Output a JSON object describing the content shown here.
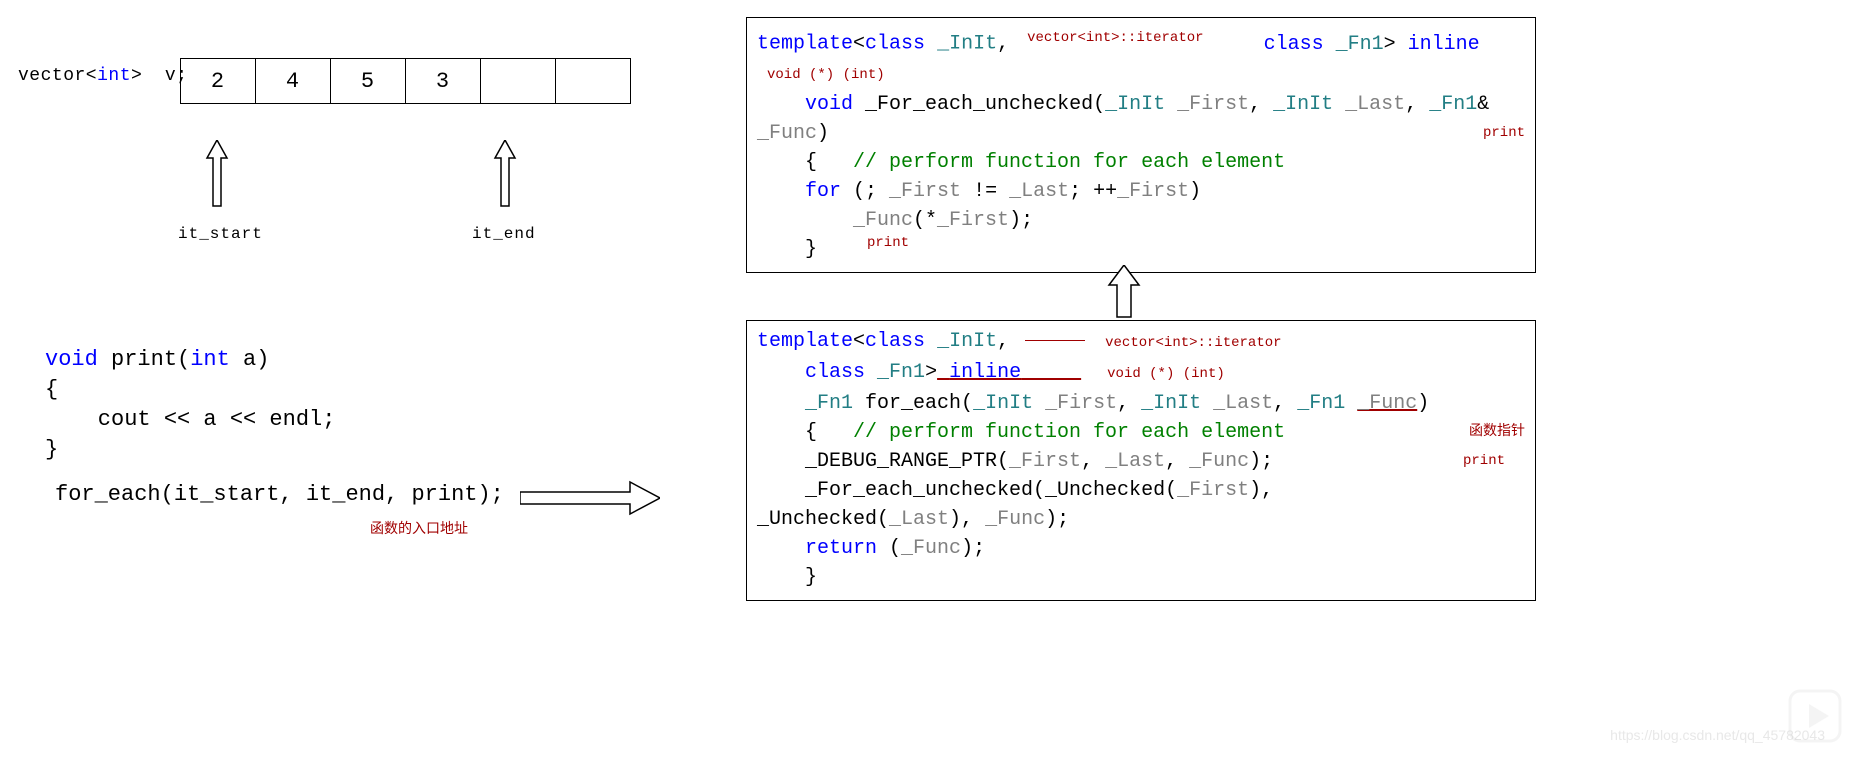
{
  "left": {
    "vector_decl_html": "vector&lt;<span class='kw'>int</span>&gt; &nbsp;v;",
    "cells": [
      "2",
      "4",
      "5",
      "3",
      "",
      ""
    ],
    "it_start": "it_start",
    "it_end": "it_end",
    "print_fn": {
      "l1_html": "<span class='kw'>void</span> print(<span class='kw'>int</span> a)",
      "l2": "{",
      "l3_html": "&nbsp;&nbsp;&nbsp;&nbsp;cout &lt;&lt; a &lt;&lt; endl;",
      "l4": "}"
    },
    "for_each_call": "for_each(it_start, it_end, print);",
    "entry_note": "函数的入口地址"
  },
  "right": {
    "anno_iterator": "vector<int>::iterator",
    "anno_voidfn": "void (*) (int)",
    "anno_print": "print",
    "anno_ptr_cn": "函数指针",
    "top": {
      "l1_html": "<span class='kw'>template</span>&lt;<span class='kw'>class</span> <span class='type'>_InIt</span>,",
      "l2_html": "&nbsp;&nbsp;&nbsp;&nbsp;<span class='kw'>class</span> <span class='type'>_Fn1</span>&gt; <span class='kw'>inline</span>",
      "l3_html": "&nbsp;&nbsp;&nbsp;&nbsp;<span class='kw'>void</span> _For_each_unchecked(<span class='type'>_InIt</span> <span class='gray'>_First</span>, <span class='type'>_InIt</span> <span class='gray'>_Last</span>, <span class='type'>_Fn1</span>&amp;",
      "l3b_html": "<span class='gray'>_Func</span>)",
      "l4_html": "&nbsp;&nbsp;&nbsp;&nbsp;{&nbsp;&nbsp;&nbsp;<span class='cmt'>// perform function for each element</span>",
      "l5_html": "&nbsp;&nbsp;&nbsp;&nbsp;<span class='kw'>for</span> (; <span class='gray'>_First</span> != <span class='gray'>_Last</span>; ++<span class='gray'>_First</span>)",
      "l6_html": "&nbsp;&nbsp;&nbsp;&nbsp;&nbsp;&nbsp;&nbsp;&nbsp;<span class='gray'>_Func</span>(*<span class='gray'>_First</span>);",
      "l7_html": "&nbsp;&nbsp;&nbsp;&nbsp;}"
    },
    "bottom": {
      "l1_html": "<span class='kw'>template</span>&lt;<span class='kw'>class</span> <span class='type'>_InIt</span>, <span class='anno-line'></span>",
      "l2_html": "&nbsp;&nbsp;&nbsp;&nbsp;<span class='kw'>class</span> <span class='type'>_Fn1</span>&gt;<span class='red-underline'>&nbsp;<span class='kw'>inline</span>&nbsp;&nbsp;&nbsp;&nbsp;&nbsp;</span>",
      "l3_html": "&nbsp;&nbsp;&nbsp;&nbsp;<span class='type'>_Fn1</span> for_each(<span class='type'>_InIt</span> <span class='gray'>_First</span>, <span class='type'>_InIt</span> <span class='gray'>_Last</span>, <span class='type'>_Fn1</span> <span class='gray red-underline'>_Func</span>)",
      "l4_html": "&nbsp;&nbsp;&nbsp;&nbsp;{&nbsp;&nbsp;&nbsp;<span class='cmt'>// perform function for each element</span>",
      "l5_html": "&nbsp;&nbsp;&nbsp;&nbsp;_DEBUG_RANGE_PTR(<span class='gray'>_First</span>, <span class='gray'>_Last</span>, <span class='gray'>_Func</span>);",
      "l6_html": "&nbsp;&nbsp;&nbsp;&nbsp;_For_each_unchecked(_Unchecked(<span class='gray'>_First</span>),",
      "l6b_html": "_Unchecked(<span class='gray'>_Last</span>), <span class='gray'>_Func</span>);",
      "l7_html": "&nbsp;&nbsp;&nbsp;&nbsp;<span class='kw'>return</span> (<span class='gray'>_Func</span>);",
      "l8_html": "&nbsp;&nbsp;&nbsp;&nbsp;}"
    }
  },
  "watermark": "https://blog.csdn.net/qq_45782043"
}
